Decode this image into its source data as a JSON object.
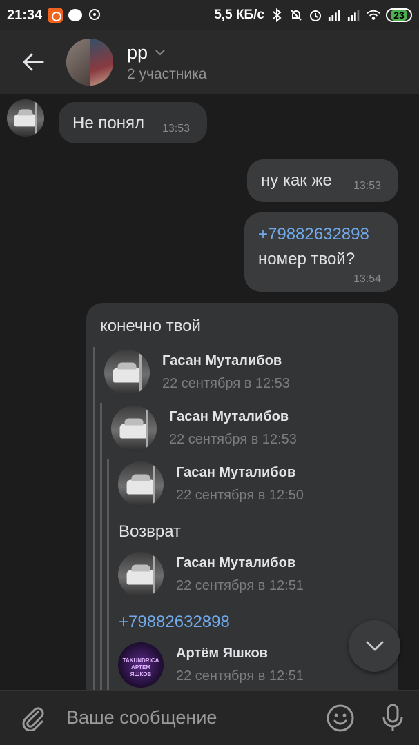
{
  "status_bar": {
    "time": "21:34",
    "speed": "5,5 КБ/с",
    "battery": "23"
  },
  "header": {
    "title": "рр",
    "subtitle": "2 участника"
  },
  "messages": [
    {
      "direction": "in",
      "text": "Не понял",
      "time": "13:53"
    },
    {
      "direction": "out",
      "text": "ну как же",
      "time": "13:53"
    },
    {
      "direction": "out",
      "phone": "+79882632898",
      "text": "номер твой?",
      "time": "13:54"
    },
    {
      "direction": "in",
      "text": "конечно твой",
      "forwards": [
        {
          "name": "Гасан Муталибов",
          "date": "22 сентября в 12:53"
        },
        {
          "name": "Гасан Муталибов",
          "date": "22 сентября в 12:53"
        },
        {
          "name": "Гасан Муталибов",
          "date": "22 сентября в 12:50"
        },
        {
          "text": "Возврат"
        },
        {
          "name": "Гасан Муталибов",
          "date": "22 сентября в 12:51"
        },
        {
          "phone": "+79882632898"
        },
        {
          "name": "Артём Яшков",
          "date": "22 сентября в 12:51",
          "avatar_text": "TAKUNDRICA АРТЕМ ЯШКОВ"
        }
      ]
    }
  ],
  "composer": {
    "placeholder": "Ваше сообщение"
  },
  "colors": {
    "background": "#1c1c1c",
    "bubble": "#3a3b3c",
    "link": "#71aaeb"
  }
}
